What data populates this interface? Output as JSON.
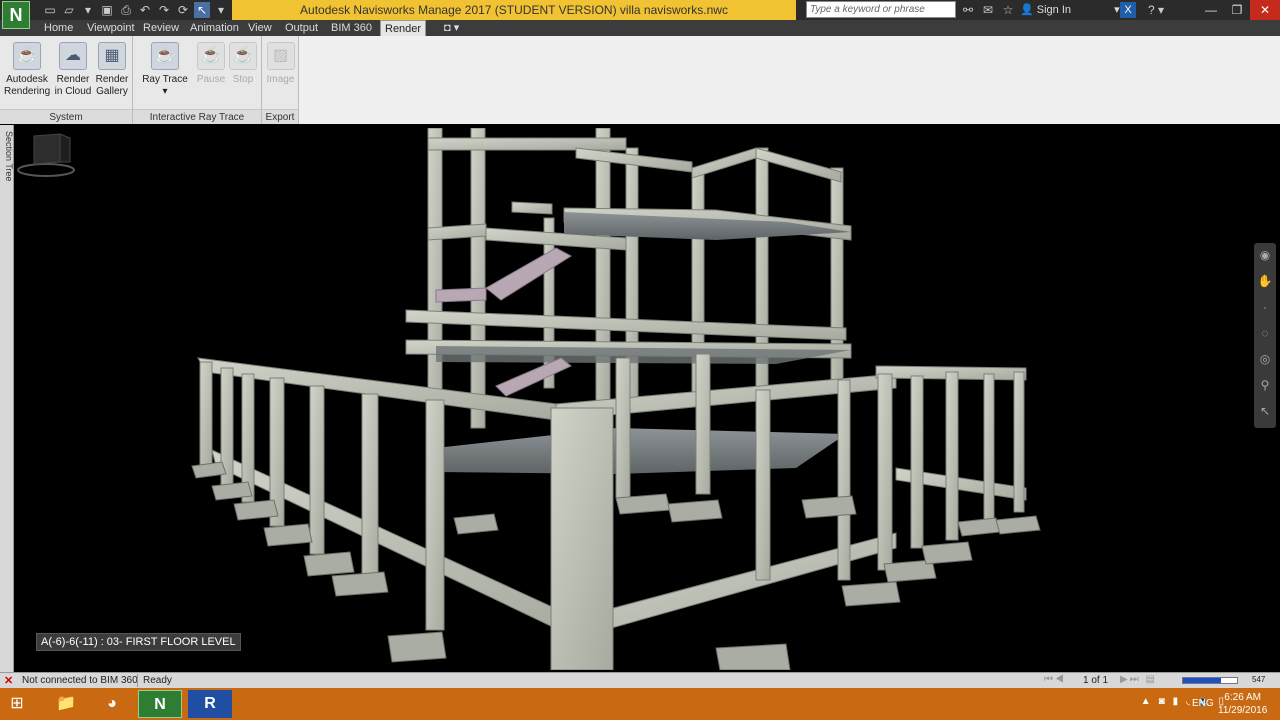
{
  "window": {
    "app_letter": "N",
    "title": "Autodesk Navisworks Manage 2017 (STUDENT VERSION)    villa navisworks.nwc",
    "search_placeholder": "Type a keyword or phrase",
    "sign_in": "Sign In"
  },
  "tabs": [
    "Home",
    "Viewpoint",
    "Review",
    "Animation",
    "View",
    "Output",
    "BIM 360",
    "Render"
  ],
  "active_tab": "Render",
  "ribbon": {
    "groups": [
      {
        "label": "System",
        "buttons": [
          {
            "label": "Autodesk Rendering",
            "line1": "Autodesk",
            "line2": "Rendering",
            "enabled": true
          },
          {
            "label": "Render in Cloud",
            "line1": "Render",
            "line2": "in Cloud",
            "enabled": true
          },
          {
            "label": "Render Gallery",
            "line1": "Render",
            "line2": "Gallery",
            "enabled": true
          }
        ]
      },
      {
        "label": "Interactive Ray Trace",
        "buttons": [
          {
            "label": "Ray Trace",
            "line1": "Ray Trace",
            "line2": "▾",
            "enabled": true
          },
          {
            "label": "Pause",
            "line1": "Pause",
            "line2": "",
            "enabled": false
          },
          {
            "label": "Stop",
            "line1": "Stop",
            "line2": "",
            "enabled": false
          }
        ]
      },
      {
        "label": "Export",
        "buttons": [
          {
            "label": "Image",
            "line1": "Image",
            "line2": "",
            "enabled": false
          }
        ]
      }
    ]
  },
  "side_panel": {
    "label": "Section Tree"
  },
  "viewport": {
    "level_label": "A(-6)-6(-11) : 03- FIRST FLOOR LEVEL",
    "background": "#000000",
    "concrete_color": "#b9bdb2"
  },
  "status": {
    "bim": "Not connected to BIM 360",
    "ready": "Ready",
    "page": "1 of 1",
    "memory": "547",
    "memory_fill": 0.7
  },
  "taskbar": {
    "apps": [
      "windows-start",
      "file-explorer",
      "chrome",
      "navisworks",
      "revit"
    ],
    "lang": "ENG",
    "time": "6:26 AM",
    "date": "11/29/2016"
  },
  "colors": {
    "title_accent": "#f1c232",
    "taskbar": "#c96a12",
    "close": "#c42b1c"
  }
}
